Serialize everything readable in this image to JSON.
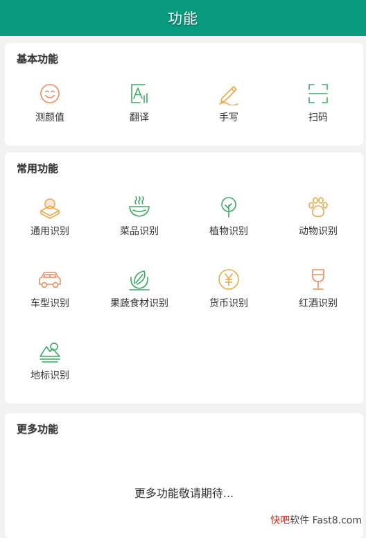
{
  "header": {
    "title": "功能"
  },
  "colors": {
    "header_bg": "#0a9a80",
    "icon_orange": "#ef8a5e",
    "icon_green": "#3aaa63",
    "icon_gold": "#e8a94a"
  },
  "basic": {
    "title": "基本功能",
    "items": [
      {
        "label": "测颜值",
        "icon": "smiley-face-icon"
      },
      {
        "label": "翻译",
        "icon": "translate-icon"
      },
      {
        "label": "手写",
        "icon": "pen-icon"
      },
      {
        "label": "扫码",
        "icon": "scan-frame-icon"
      }
    ]
  },
  "common": {
    "title": "常用功能",
    "items": [
      {
        "label": "通用识别",
        "icon": "box-ball-icon"
      },
      {
        "label": "菜品识别",
        "icon": "steaming-bowl-icon"
      },
      {
        "label": "植物识别",
        "icon": "tree-icon"
      },
      {
        "label": "动物识别",
        "icon": "paw-icon"
      },
      {
        "label": "车型识别",
        "icon": "car-icon"
      },
      {
        "label": "果蔬食材识别",
        "icon": "leaf-bowl-icon"
      },
      {
        "label": "货币识别",
        "icon": "yen-coin-icon"
      },
      {
        "label": "红酒识别",
        "icon": "wine-glass-icon"
      },
      {
        "label": "地标识别",
        "icon": "landmark-icon"
      }
    ]
  },
  "more": {
    "title": "更多功能",
    "message": "更多功能敬请期待..."
  },
  "watermark": {
    "brand": "快吧",
    "text": "软件 Fast8.com"
  }
}
